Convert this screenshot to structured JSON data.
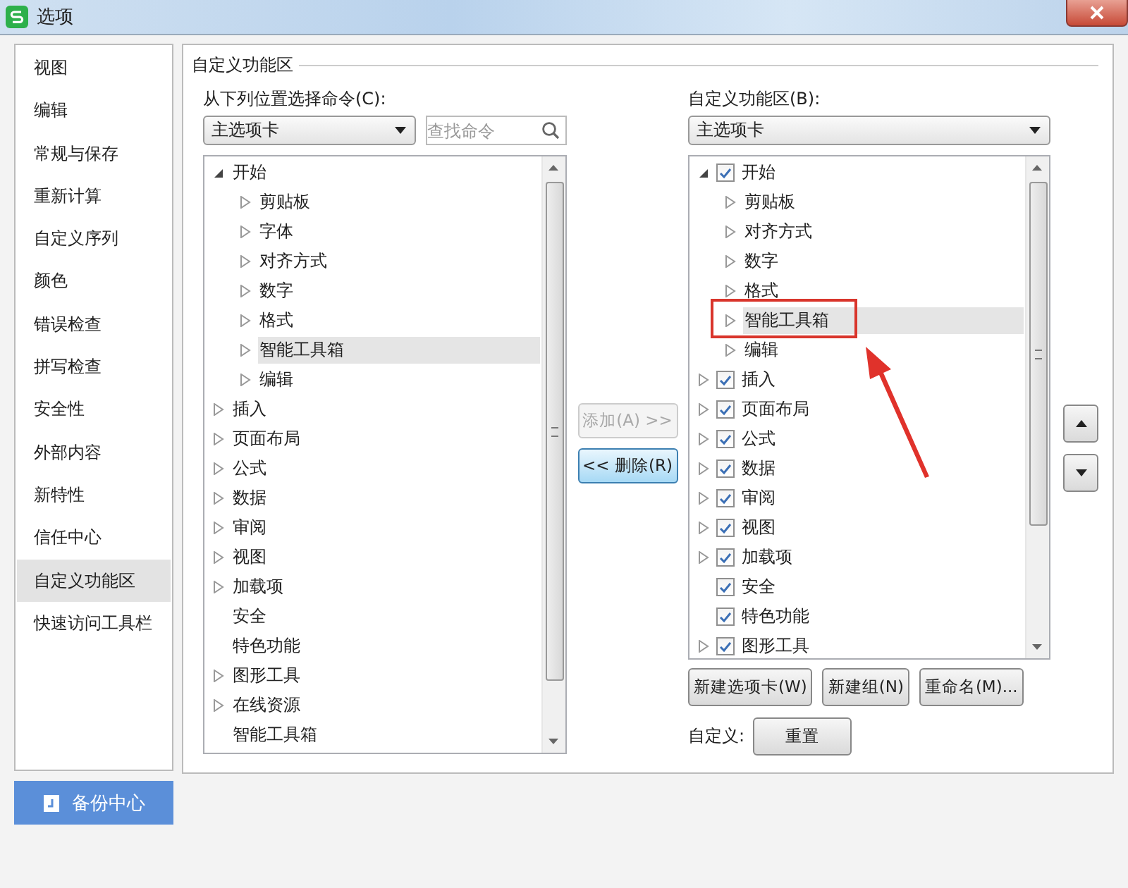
{
  "window": {
    "title": "选项"
  },
  "sidebar": {
    "items": [
      {
        "label": "视图",
        "selected": false
      },
      {
        "label": "编辑",
        "selected": false
      },
      {
        "label": "常规与保存",
        "selected": false
      },
      {
        "label": "重新计算",
        "selected": false
      },
      {
        "label": "自定义序列",
        "selected": false
      },
      {
        "label": "颜色",
        "selected": false
      },
      {
        "label": "错误检查",
        "selected": false
      },
      {
        "label": "拼写检查",
        "selected": false
      },
      {
        "label": "安全性",
        "selected": false
      },
      {
        "label": "外部内容",
        "selected": false
      },
      {
        "label": "新特性",
        "selected": false
      },
      {
        "label": "信任中心",
        "selected": false
      },
      {
        "label": "自定义功能区",
        "selected": true
      },
      {
        "label": "快速访问工具栏",
        "selected": false
      }
    ],
    "backup_button": {
      "label": "备份中心"
    }
  },
  "section": {
    "title": "自定义功能区",
    "left": {
      "label": "从下列位置选择命令(C):",
      "dropdown": {
        "value": "主选项卡"
      },
      "search": {
        "placeholder": "查找命令"
      },
      "tree": [
        {
          "label": "开始",
          "kind": "group",
          "expanded": true,
          "selected": false,
          "children": [
            {
              "label": "剪贴板",
              "kind": "group",
              "expanded": false,
              "selected": false
            },
            {
              "label": "字体",
              "kind": "group",
              "expanded": false,
              "selected": false
            },
            {
              "label": "对齐方式",
              "kind": "group",
              "expanded": false,
              "selected": false
            },
            {
              "label": "数字",
              "kind": "group",
              "expanded": false,
              "selected": false
            },
            {
              "label": "格式",
              "kind": "group",
              "expanded": false,
              "selected": false
            },
            {
              "label": "智能工具箱",
              "kind": "group",
              "expanded": false,
              "selected": true
            },
            {
              "label": "编辑",
              "kind": "group",
              "expanded": false,
              "selected": false
            }
          ]
        },
        {
          "label": "插入",
          "kind": "group",
          "expanded": false,
          "selected": false
        },
        {
          "label": "页面布局",
          "kind": "group",
          "expanded": false,
          "selected": false
        },
        {
          "label": "公式",
          "kind": "group",
          "expanded": false,
          "selected": false
        },
        {
          "label": "数据",
          "kind": "group",
          "expanded": false,
          "selected": false
        },
        {
          "label": "审阅",
          "kind": "group",
          "expanded": false,
          "selected": false
        },
        {
          "label": "视图",
          "kind": "group",
          "expanded": false,
          "selected": false
        },
        {
          "label": "加载项",
          "kind": "group",
          "expanded": false,
          "selected": false
        },
        {
          "label": "安全",
          "kind": "command",
          "selected": false
        },
        {
          "label": "特色功能",
          "kind": "command",
          "selected": false
        },
        {
          "label": "图形工具",
          "kind": "group",
          "expanded": false,
          "selected": false
        },
        {
          "label": "在线资源",
          "kind": "group",
          "expanded": false,
          "selected": false
        },
        {
          "label": "智能工具箱",
          "kind": "command",
          "selected": false
        }
      ]
    },
    "add_button": {
      "label": "添加(A) >>",
      "disabled": true
    },
    "remove_button": {
      "label": "<< 删除(R)",
      "disabled": false
    },
    "right": {
      "label": "自定义功能区(B):",
      "dropdown": {
        "value": "主选项卡"
      },
      "tree": [
        {
          "label": "开始",
          "kind": "group",
          "expanded": true,
          "checked": true,
          "selected": false,
          "children": [
            {
              "label": "剪贴板",
              "kind": "group",
              "expanded": false,
              "selected": false
            },
            {
              "label": "对齐方式",
              "kind": "group",
              "expanded": false,
              "selected": false
            },
            {
              "label": "数字",
              "kind": "group",
              "expanded": false,
              "selected": false
            },
            {
              "label": "格式",
              "kind": "group",
              "expanded": false,
              "selected": false
            },
            {
              "label": "智能工具箱",
              "kind": "group",
              "expanded": false,
              "selected": true
            },
            {
              "label": "编辑",
              "kind": "group",
              "expanded": false,
              "selected": false
            }
          ]
        },
        {
          "label": "插入",
          "kind": "group",
          "expanded": false,
          "checked": true,
          "selected": false
        },
        {
          "label": "页面布局",
          "kind": "group",
          "expanded": false,
          "checked": true,
          "selected": false
        },
        {
          "label": "公式",
          "kind": "group",
          "expanded": false,
          "checked": true,
          "selected": false
        },
        {
          "label": "数据",
          "kind": "group",
          "expanded": false,
          "checked": true,
          "selected": false
        },
        {
          "label": "审阅",
          "kind": "group",
          "expanded": false,
          "checked": true,
          "selected": false
        },
        {
          "label": "视图",
          "kind": "group",
          "expanded": false,
          "checked": true,
          "selected": false
        },
        {
          "label": "加载项",
          "kind": "group",
          "expanded": false,
          "checked": true,
          "selected": false
        },
        {
          "label": "安全",
          "kind": "command",
          "checked": true,
          "selected": false
        },
        {
          "label": "特色功能",
          "kind": "command",
          "checked": true,
          "selected": false
        },
        {
          "label": "图形工具",
          "kind": "group",
          "expanded": false,
          "checked": true,
          "selected": false
        }
      ],
      "buttons": [
        "新建选项卡(W)",
        "新建组(N)",
        "重命名(M)..."
      ]
    },
    "customize": {
      "label": "自定义:",
      "button": "重置"
    }
  }
}
